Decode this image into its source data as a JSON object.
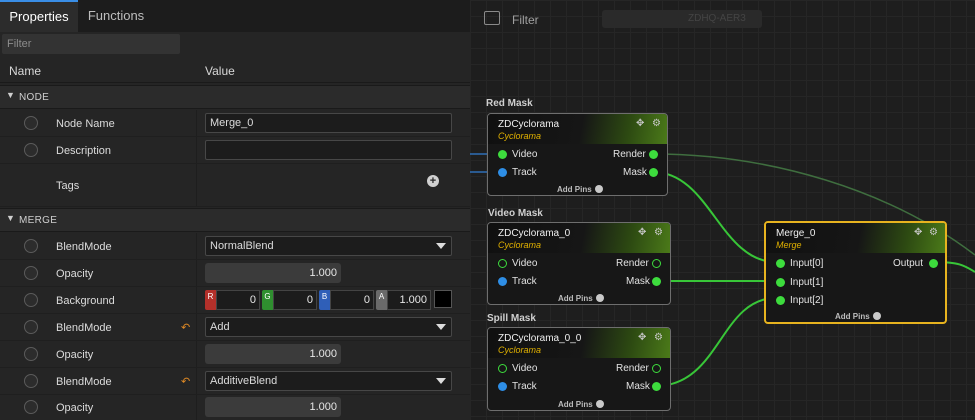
{
  "tabs": [
    {
      "label": "Properties",
      "active": true
    },
    {
      "label": "Functions",
      "active": false
    }
  ],
  "properties": {
    "filter_placeholder": "Filter",
    "columns": {
      "name": "Name",
      "value": "Value"
    },
    "sections": [
      {
        "label": "NODE"
      },
      {
        "label": "MERGE"
      }
    ],
    "node": {
      "node_name_label": "Node Name",
      "node_name_value": "Merge_0",
      "description_label": "Description",
      "description_value": "",
      "tags_label": "Tags"
    },
    "merge": {
      "blend1_label": "BlendMode",
      "blend1_value": "NormalBlend",
      "opacity1_label": "Opacity",
      "opacity1_value": "1.000",
      "background_label": "Background",
      "background": {
        "r": "0",
        "g": "0",
        "b": "0",
        "a": "1.000"
      },
      "blend2_label": "BlendMode",
      "blend2_value": "Add",
      "opacity2_label": "Opacity",
      "opacity2_value": "1.000",
      "blend3_label": "BlendMode",
      "blend3_value": "AdditiveBlend",
      "opacity3_label": "Opacity",
      "opacity3_value": "1.000"
    },
    "channel_labels": {
      "r": "R",
      "g": "G",
      "b": "B",
      "a": "A"
    }
  },
  "graph": {
    "filter_label": "Filter",
    "filter_value": "ZDHQ-AER3",
    "groups": [
      {
        "label": "Red Mask"
      },
      {
        "label": "Video Mask"
      },
      {
        "label": "Spill Mask"
      }
    ],
    "nodes": [
      {
        "title": "ZDCyclorama",
        "type": "Cyclorama",
        "pins_in": [
          "Video",
          "Track"
        ],
        "pins_out": [
          "Render",
          "Mask"
        ],
        "add_pins": "Add Pins"
      },
      {
        "title": "ZDCyclorama_0",
        "type": "Cyclorama",
        "pins_in": [
          "Video",
          "Track"
        ],
        "pins_out": [
          "Render",
          "Mask"
        ],
        "add_pins": "Add Pins"
      },
      {
        "title": "ZDCyclorama_0_0",
        "type": "Cyclorama",
        "pins_in": [
          "Video",
          "Track"
        ],
        "pins_out": [
          "Render",
          "Mask"
        ],
        "add_pins": "Add Pins"
      },
      {
        "title": "Merge_0",
        "type": "Merge",
        "pins_in": [
          "Input[0]",
          "Input[1]",
          "Input[2]"
        ],
        "pins_out": [
          "Output"
        ],
        "add_pins": "Add Pins"
      }
    ]
  },
  "colors": {
    "accent": "#3a8ee6",
    "pin_green": "#3ddc3d",
    "pin_blue": "#2e8ee6",
    "selection": "#e7b31f",
    "type_label": "#e2b200"
  },
  "icons": {
    "move": "move-icon",
    "settings": "gear-icon",
    "add": "add-icon",
    "revert": "revert-icon",
    "dropdown": "chevron-down-icon"
  }
}
